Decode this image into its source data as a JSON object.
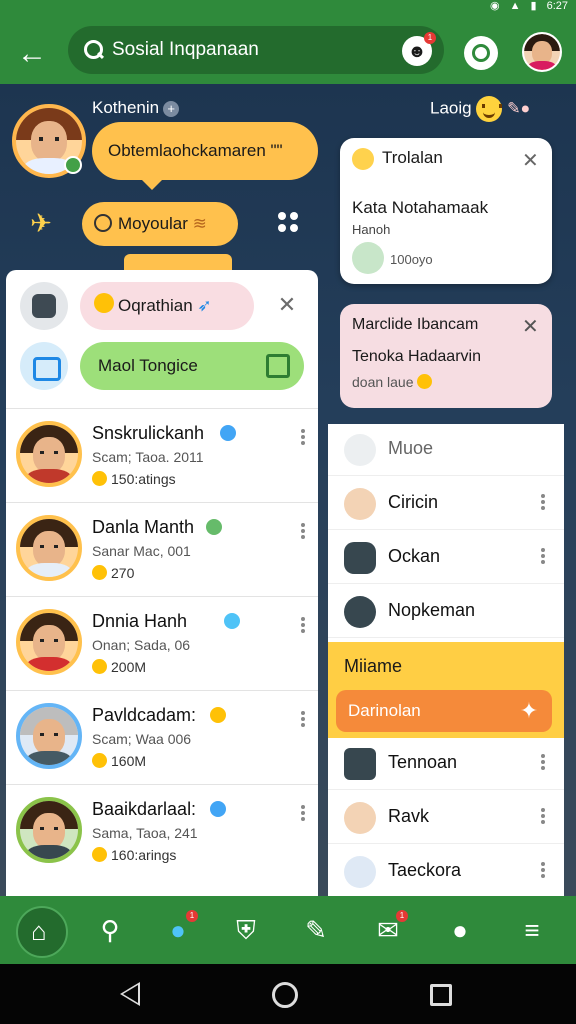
{
  "status": {
    "time": "6:27"
  },
  "appbar": {
    "search_text": "Sosial Inqpanaan",
    "notif_badge": "1"
  },
  "header": {
    "name": "Kothenin",
    "right_label": "Laoig"
  },
  "bubble": {
    "text": "Obtemlaohckamaren \"\""
  },
  "popular": {
    "label": "Moyoular"
  },
  "left_panel": {
    "chip1": "Oqrathian",
    "chip2": "Maol Tongice",
    "contacts": [
      {
        "name": "Snskrulickanh",
        "sub": "Scam; Taoa. 2011",
        "stat": "150:atings"
      },
      {
        "name": "Danla Manth",
        "sub": "Sanar Mac, 001",
        "stat": "270"
      },
      {
        "name": "Dnnia Hanh",
        "sub": "Onan; Sada, 06",
        "stat": "200M"
      },
      {
        "name": "Pavldcadam:",
        "sub": "Scam; Waa 006",
        "stat": "160M"
      },
      {
        "name": "Baaikdarlaal:",
        "sub": "Sama, Taoa, 241",
        "stat": "160:arings"
      }
    ]
  },
  "right_top_card": {
    "title": "Trolalan",
    "line1": "Kata Notahamaak",
    "line2": "Hanoh",
    "line3": "100oyo"
  },
  "right_pink_card": {
    "line1": "Marclide Ibancam",
    "line2": "Tenoka Hadaarvin",
    "line3": "doan laue"
  },
  "right_list": {
    "items_top": [
      {
        "label": "Muoe"
      },
      {
        "label": "Ciricin"
      },
      {
        "label": "Ockan"
      },
      {
        "label": "Nopkeman"
      }
    ],
    "highlight_label": "Miiame",
    "highlight_button": "Darinolan",
    "items_bottom": [
      {
        "label": "Tennoan"
      },
      {
        "label": "Ravk"
      },
      {
        "label": "Taeckora"
      }
    ]
  },
  "nav": {
    "chat_badge": "1",
    "mail_badge": "1"
  },
  "colors": {
    "primary": "#2f8a3b",
    "accent": "#ffc14d",
    "orange": "#f58a3a"
  }
}
